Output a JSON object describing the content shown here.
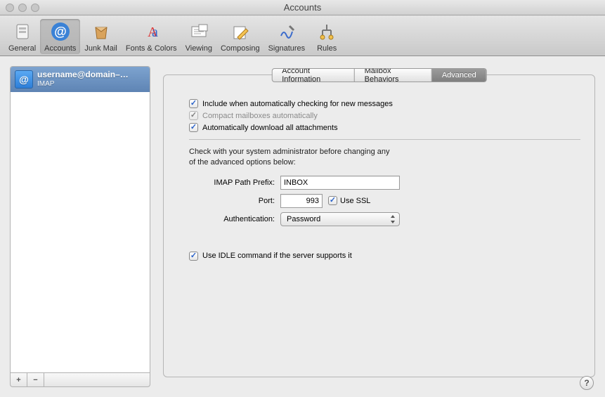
{
  "window": {
    "title": "Accounts"
  },
  "toolbar": [
    {
      "key": "general",
      "label": "General",
      "selected": false
    },
    {
      "key": "accounts",
      "label": "Accounts",
      "selected": true
    },
    {
      "key": "junk",
      "label": "Junk Mail",
      "selected": false
    },
    {
      "key": "fonts",
      "label": "Fonts & Colors",
      "selected": false
    },
    {
      "key": "viewing",
      "label": "Viewing",
      "selected": false
    },
    {
      "key": "composing",
      "label": "Composing",
      "selected": false
    },
    {
      "key": "signatures",
      "label": "Signatures",
      "selected": false
    },
    {
      "key": "rules",
      "label": "Rules",
      "selected": false
    }
  ],
  "sidebar": {
    "accounts": [
      {
        "name": "username@domain–…",
        "type": "IMAP",
        "selected": true
      }
    ],
    "add_label": "+",
    "remove_label": "−"
  },
  "tabs": [
    {
      "key": "info",
      "label": "Account Information",
      "active": false
    },
    {
      "key": "mailbox",
      "label": "Mailbox Behaviors",
      "active": false
    },
    {
      "key": "advanced",
      "label": "Advanced",
      "active": true
    }
  ],
  "advanced": {
    "include_check_label": "Include when automatically checking for new messages",
    "include_check_checked": true,
    "compact_label": "Compact mailboxes automatically",
    "compact_checked": true,
    "compact_disabled": true,
    "autodl_label": "Automatically download all attachments",
    "autodl_checked": true,
    "hint_line1": "Check with your system administrator before changing any",
    "hint_line2": "of the advanced options below:",
    "imap_prefix_label": "IMAP Path Prefix:",
    "imap_prefix_value": "INBOX",
    "port_label": "Port:",
    "port_value": "993",
    "use_ssl_label": "Use SSL",
    "use_ssl_checked": true,
    "auth_label": "Authentication:",
    "auth_value": "Password",
    "idle_label": "Use IDLE command if the server supports it",
    "idle_checked": true
  },
  "help_label": "?"
}
